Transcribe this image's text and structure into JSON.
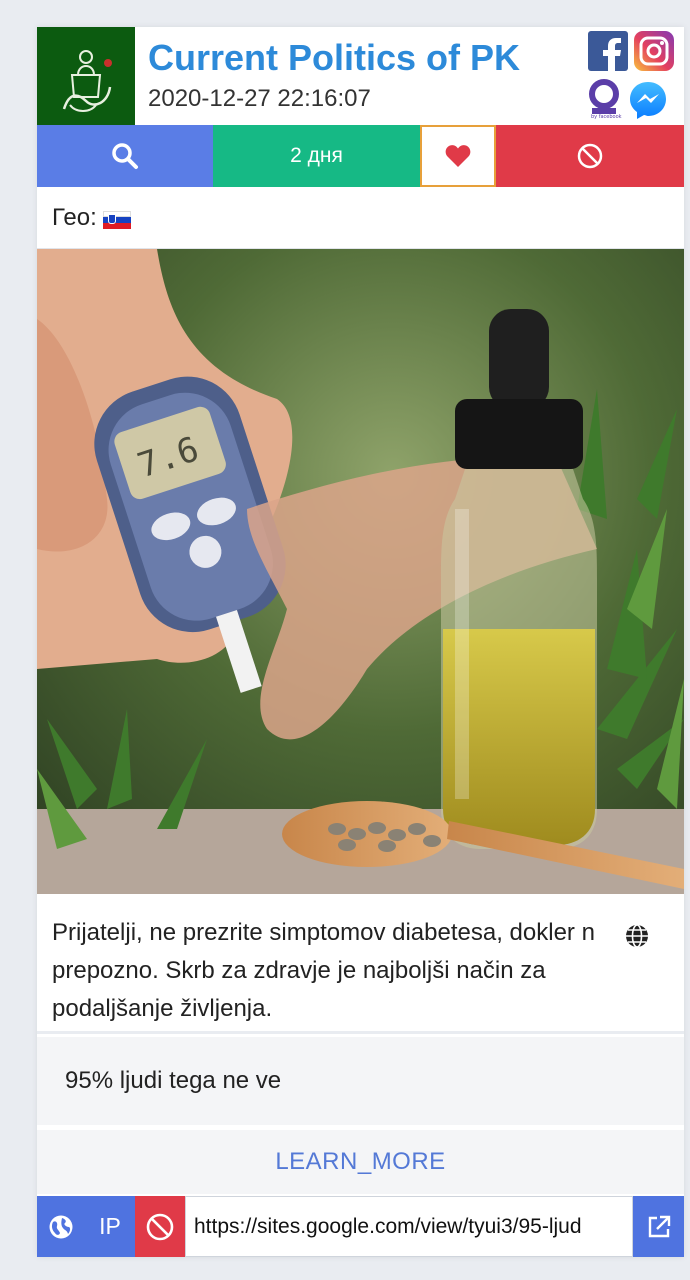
{
  "header": {
    "title": "Current Politics of PK",
    "timestamp": "2020-12-27 22:16:07",
    "avatar_icon": "pk-logo-icon",
    "socials": [
      "facebook-icon",
      "instagram-icon",
      "audience-network-icon",
      "messenger-icon"
    ]
  },
  "actions": {
    "search_icon": "search-icon",
    "duration": "2 дня",
    "like_icon": "heart-icon",
    "block_icon": "block-icon"
  },
  "geo": {
    "label": "Гео:",
    "flag": "slovenia-flag-icon"
  },
  "ad": {
    "image_alt": "glucose meter and cbd oil bottle",
    "description": "Prijatelji, ne prezrite simptomov diabetesa, dokler n prepozno. Skrb za zdravje je najboljši način za podaljšanje življenja.",
    "headline": "95% ljudi tega ne ve",
    "cta": "LEARN_MORE"
  },
  "bottom": {
    "ip_label": "IP",
    "url": "https://sites.google.com/view/tyui3/95-ljud"
  },
  "colors": {
    "title": "#2d8ad9",
    "search": "#5a7de6",
    "days": "#16b985",
    "block": "#e03a48",
    "cta": "#5479d6"
  }
}
